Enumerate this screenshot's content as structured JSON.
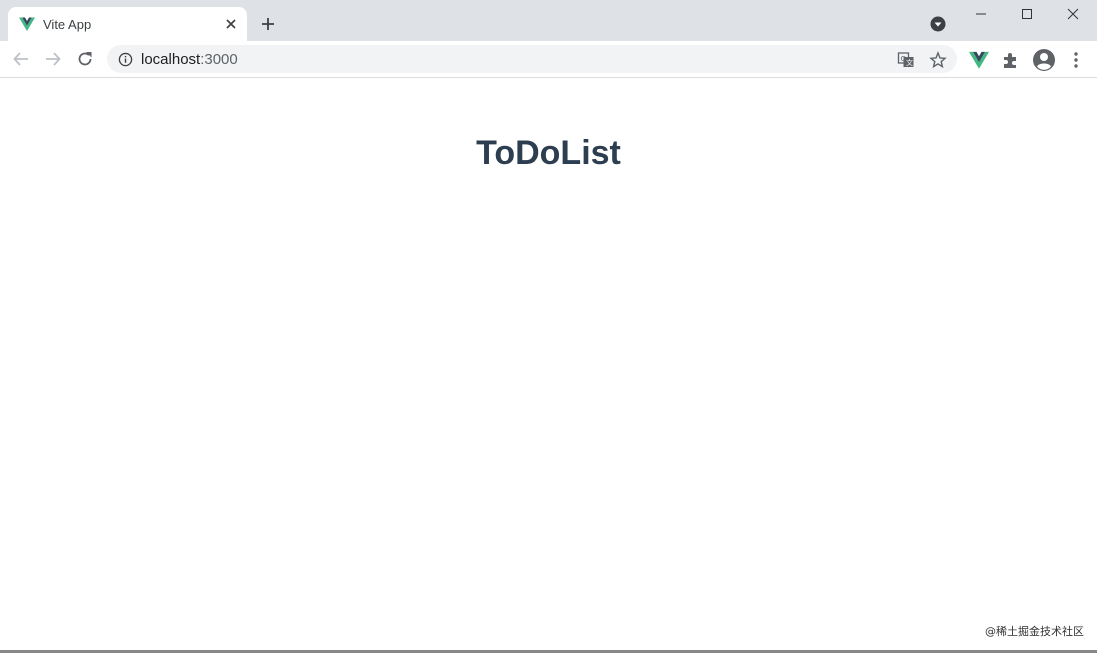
{
  "tab": {
    "title": "Vite App"
  },
  "address_bar": {
    "host": "localhost",
    "port": ":3000"
  },
  "page": {
    "heading": "ToDoList"
  },
  "watermark": "@稀土掘金技术社区",
  "colors": {
    "vue_green": "#42b883",
    "vue_dark": "#35495e",
    "heading": "#2c3e50"
  }
}
